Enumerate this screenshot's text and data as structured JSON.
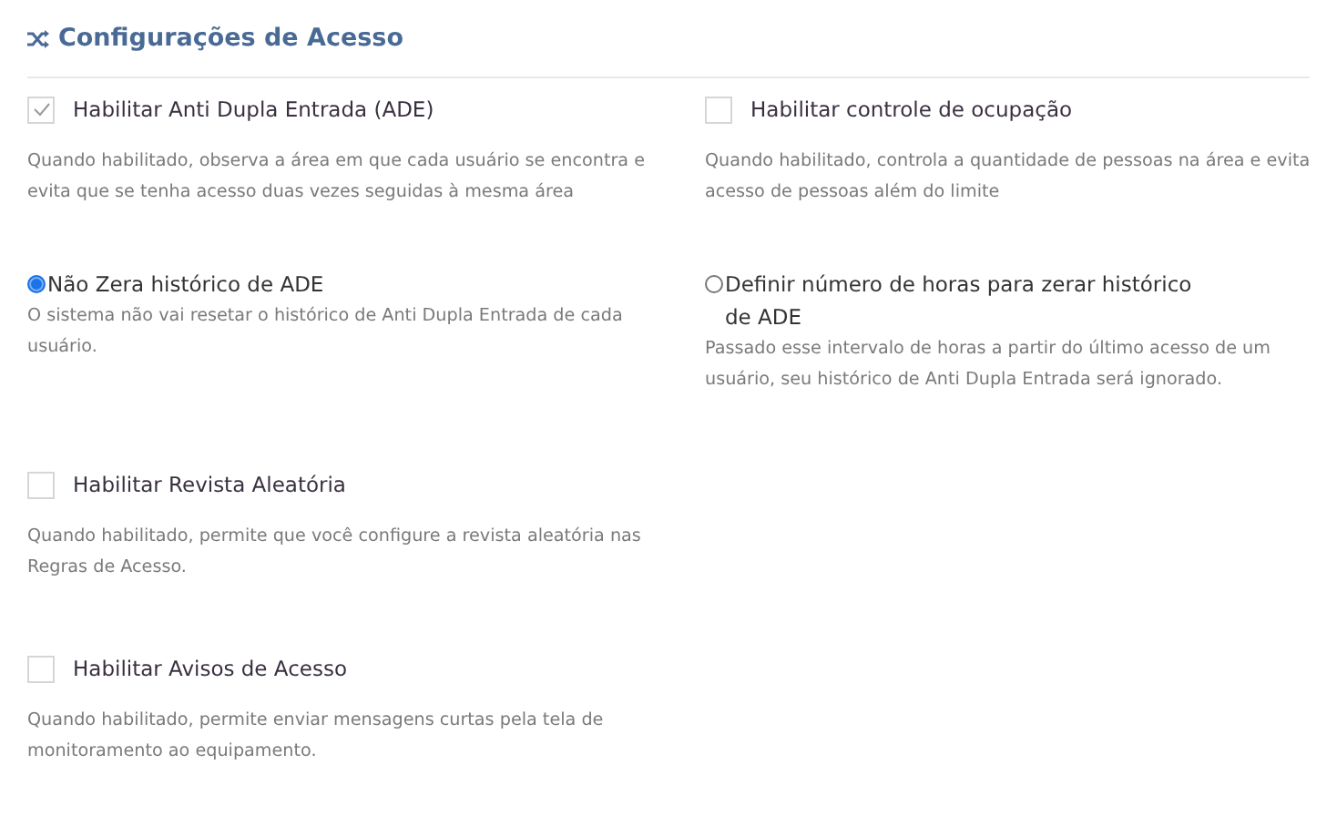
{
  "title": "Configurações de Acesso",
  "rows": [
    [
      {
        "kind": "checkbox",
        "label": "Habilitar Anti Dupla Entrada (ADE)",
        "checked": true,
        "description": "Quando habilitado, observa a área em que cada usuário se encontra e evita que se tenha acesso duas vezes seguidas à mesma área"
      },
      {
        "kind": "checkbox",
        "label": "Habilitar controle de ocupação",
        "checked": false,
        "description": "Quando habilitado, controla a quantidade de pessoas na área e evita acesso de pessoas além do limite"
      }
    ],
    [
      {
        "kind": "radio",
        "label": "Não Zera histórico de ADE",
        "selected": true,
        "description": "O sistema não vai resetar o histórico de Anti Dupla Entrada de cada usuário."
      },
      {
        "kind": "radio",
        "label": "Definir número de horas para zerar histórico de ADE",
        "selected": false,
        "description": "Passado esse intervalo de horas a partir do último acesso de um usuário, seu histórico de Anti Dupla Entrada será ignorado."
      }
    ],
    [
      {
        "kind": "checkbox",
        "label": "Habilitar Revista Aleatória",
        "checked": false,
        "description": "Quando habilitado, permite que você configure a revista aleatória nas Regras de Acesso."
      }
    ],
    [
      {
        "kind": "checkbox",
        "label": "Habilitar Avisos de Acesso",
        "checked": false,
        "description": "Quando habilitado, permite enviar mensagens curtas pela tela de monitoramento ao equipamento."
      }
    ]
  ]
}
